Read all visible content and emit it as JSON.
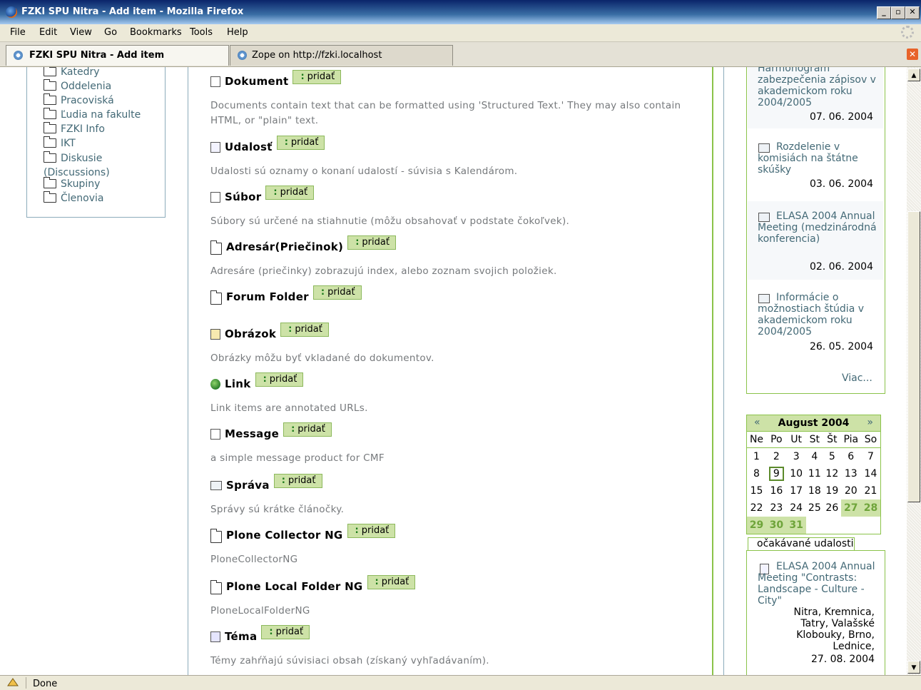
{
  "window": {
    "title": "FZKI SPU Nitra - Add item - Mozilla Firefox"
  },
  "menu": [
    "File",
    "Edit",
    "View",
    "Go",
    "Bookmarks",
    "Tools",
    "Help"
  ],
  "tabs": [
    {
      "label": "FZKI SPU Nitra - Add item",
      "active": true
    },
    {
      "label": "Zope on http://fzki.localhost",
      "active": false
    }
  ],
  "left_nav": [
    "Katedry",
    "Oddelenia",
    "Pracoviská",
    "Ľudia na fakulte",
    "FZKI Info",
    "IKT",
    "Diskusie (Discussions)",
    "Skupiny",
    "Členovia"
  ],
  "add_label": "pridať",
  "content_types": [
    {
      "name": "Dokument",
      "icon": "document-icon",
      "desc": "Documents contain text that can be formatted using 'Structured Text.' They may also contain HTML, or \"plain\" text."
    },
    {
      "name": "Udalosť",
      "icon": "event-icon",
      "desc": "Udalosti sú oznamy o konaní udalostí - súvisia s Kalendárom."
    },
    {
      "name": "Súbor",
      "icon": "file-icon",
      "desc": "Súbory sú určené na stiahnutie (môžu obsahovať v podstate čokoľvek)."
    },
    {
      "name": "Adresár(Priečinok)",
      "icon": "folder-icon",
      "desc": "Adresáre (priečinky) zobrazujú index, alebo zoznam svojich položiek."
    },
    {
      "name": "Forum Folder",
      "icon": "forum-folder-icon",
      "desc": ""
    },
    {
      "name": "Obrázok",
      "icon": "image-icon",
      "desc": "Obrázky môžu byť vkladané do dokumentov."
    },
    {
      "name": "Link",
      "icon": "link-icon",
      "desc": "Link items are annotated URLs."
    },
    {
      "name": "Message",
      "icon": "message-icon",
      "desc": "a simple message product for CMF"
    },
    {
      "name": "Správa",
      "icon": "news-icon",
      "desc": "Správy sú krátke článočky."
    },
    {
      "name": "Plone Collector NG",
      "icon": "folder-icon",
      "desc": "PloneCollectorNG"
    },
    {
      "name": "Plone Local Folder NG",
      "icon": "folder-icon",
      "desc": "PloneLocalFolderNG"
    },
    {
      "name": "Téma",
      "icon": "topic-icon",
      "desc": "Témy zahŕňajú súvisiaci obsah (získaný vyhľadávaním)."
    }
  ],
  "news": {
    "top_partial": {
      "title": "Harmonogram zabezpečenia zápisov v akademickom roku 2004/2005",
      "date": "07. 06. 2004"
    },
    "items": [
      {
        "title": "Rozdelenie v komisiách na štátne skúšky",
        "date": "03. 06. 2004"
      },
      {
        "title": "ELASA 2004 Annual Meeting (medzinárodná konferencia)",
        "date": "02. 06. 2004"
      },
      {
        "title": "Informácie o možnostiach štúdia v akademickom roku 2004/2005",
        "date": "26. 05. 2004"
      }
    ],
    "more": "Viac..."
  },
  "calendar": {
    "month": "August 2004",
    "prev": "«",
    "next": "»",
    "days": [
      "Ne",
      "Po",
      "Ut",
      "St",
      "Št",
      "Pia",
      "So"
    ],
    "weeks": [
      [
        "1",
        "2",
        "3",
        "4",
        "5",
        "6",
        "7"
      ],
      [
        "8",
        "9",
        "10",
        "11",
        "12",
        "13",
        "14"
      ],
      [
        "15",
        "16",
        "17",
        "18",
        "19",
        "20",
        "21"
      ],
      [
        "22",
        "23",
        "24",
        "25",
        "26",
        "27",
        "28"
      ],
      [
        "29",
        "30",
        "31",
        "",
        "",
        "",
        ""
      ]
    ],
    "today": "9",
    "event_days": [
      "27",
      "28",
      "29",
      "30",
      "31"
    ]
  },
  "upcoming": {
    "heading": "očakávané udalosti",
    "event": {
      "title": "ELASA 2004 Annual Meeting \"Contrasts: Landscape - Culture - City\"",
      "location": "Nitra, Kremnica, Tatry, Valašské Klobouky, Brno, Lednice,",
      "date": "27. 08. 2004"
    }
  },
  "status": "Done"
}
